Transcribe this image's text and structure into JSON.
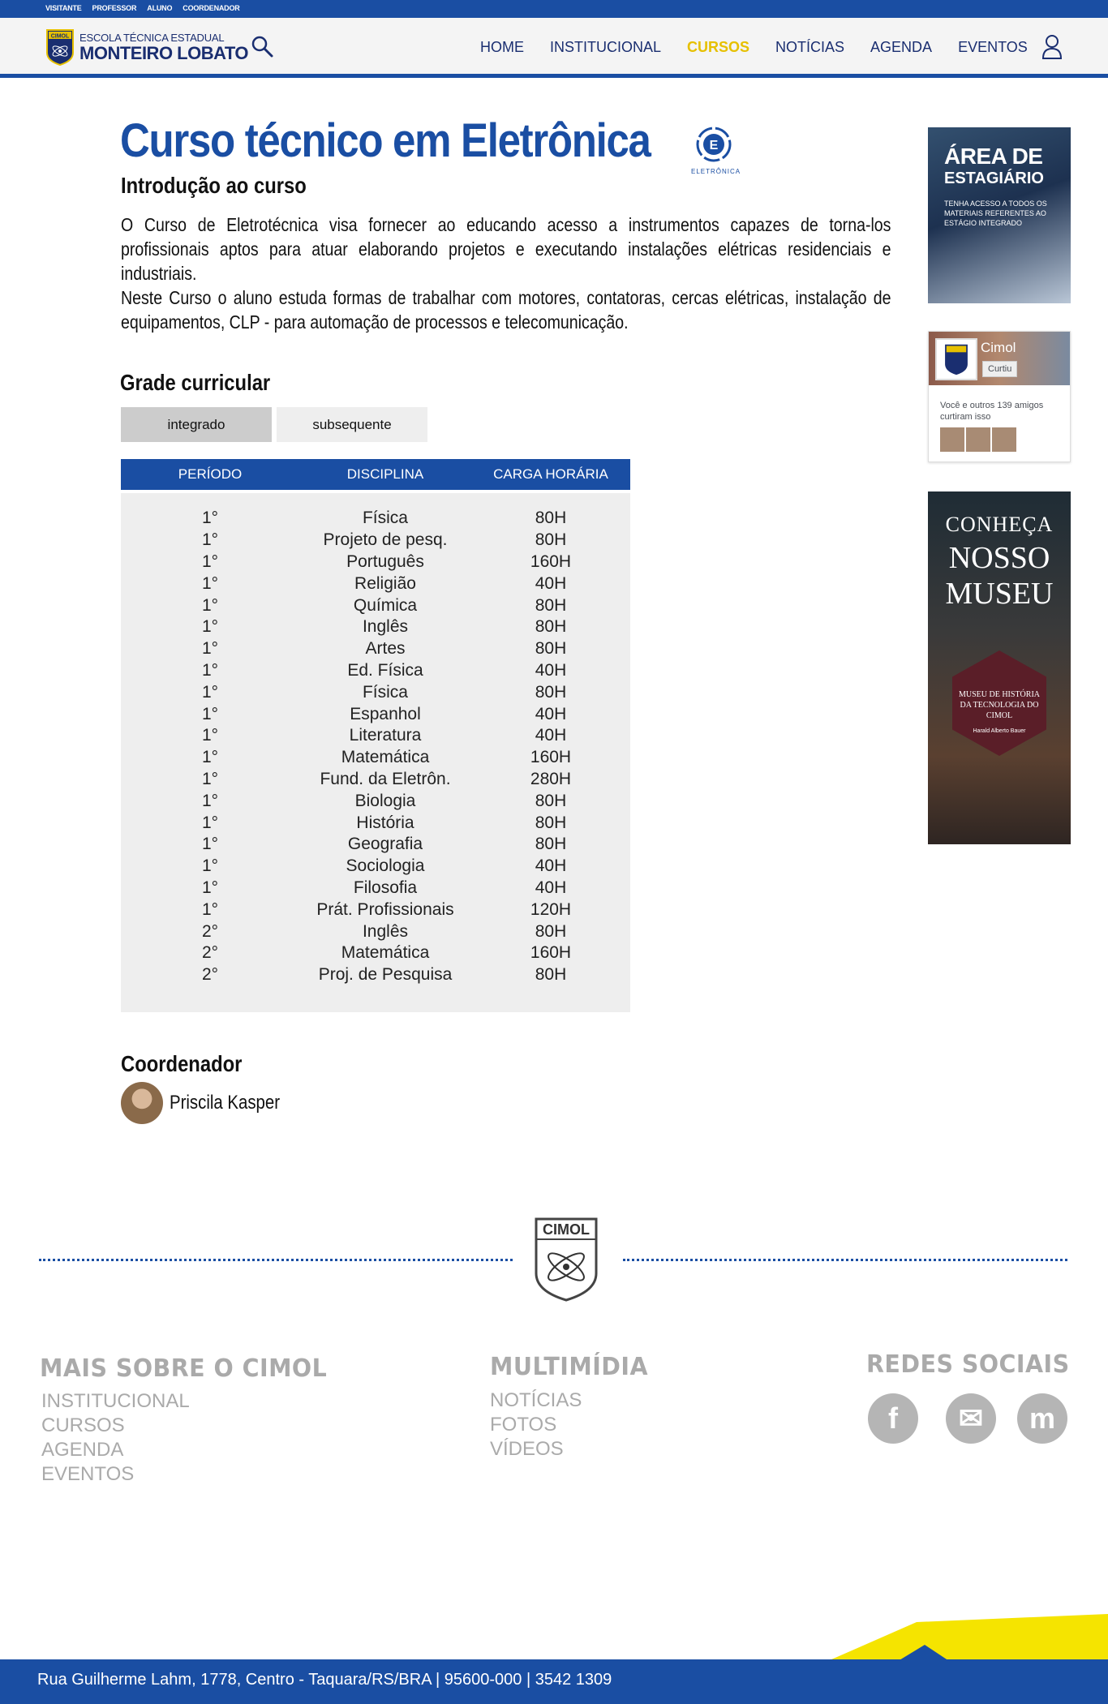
{
  "topbar": {
    "links": [
      "VISITANTE",
      "PROFESSOR",
      "ALUNO",
      "COORDENADOR"
    ]
  },
  "header": {
    "crest_text": "CIMOL",
    "school_sub": "ESCOLA TÉCNICA ESTADUAL",
    "school_main": "MONTEIRO LOBATO",
    "nav": [
      "HOME",
      "INSTITUCIONAL",
      "CURSOS",
      "NOTÍCIAS",
      "AGENDA",
      "EVENTOS"
    ],
    "active_nav": "CURSOS"
  },
  "main": {
    "title": "Curso técnico em Eletrônica",
    "badge_label": "ELETRÔNICA",
    "intro_heading": "Introdução ao curso",
    "intro_p1": "O Curso de Eletrotécnica visa fornecer ao educando acesso a instrumentos capazes de torna-los profissionais aptos para atuar elaborando projetos e executando instalações elétricas residenciais e industriais.",
    "intro_p2": "Neste Curso o aluno estuda formas de trabalhar com motores, contatoras, cercas elétricas, instalação de equipamentos, CLP - para automação de processos e telecomunicação.",
    "grade_heading": "Grade curricular",
    "tabs": [
      "integrado",
      "subsequente"
    ],
    "table": {
      "headers": [
        "PERÍODO",
        "DISCIPLINA",
        "CARGA HORÁRIA"
      ],
      "rows": [
        [
          "1°",
          "Física",
          "80H"
        ],
        [
          "1°",
          "Projeto de pesq.",
          "80H"
        ],
        [
          "1°",
          "Português",
          "160H"
        ],
        [
          "1°",
          "Religião",
          "40H"
        ],
        [
          "1°",
          "Química",
          "80H"
        ],
        [
          "1°",
          "Inglês",
          "80H"
        ],
        [
          "1°",
          "Artes",
          "80H"
        ],
        [
          "1°",
          "Ed. Física",
          "40H"
        ],
        [
          "1°",
          "Física",
          "80H"
        ],
        [
          "1°",
          "Espanhol",
          "40H"
        ],
        [
          "1°",
          "Literatura",
          "40H"
        ],
        [
          "1°",
          "Matemática",
          "160H"
        ],
        [
          "1°",
          "Fund. da Eletrôn.",
          "280H"
        ],
        [
          "1°",
          "Biologia",
          "80H"
        ],
        [
          "1°",
          "História",
          "80H"
        ],
        [
          "1°",
          "Geografia",
          "80H"
        ],
        [
          "1°",
          "Sociologia",
          "40H"
        ],
        [
          "1°",
          "Filosofia",
          "40H"
        ],
        [
          "1°",
          "Prát. Profissionais",
          "120H"
        ],
        [
          "2°",
          "Inglês",
          "80H"
        ],
        [
          "2°",
          "Matemática",
          "160H"
        ],
        [
          "2°",
          "Proj. de Pesquisa",
          "80H"
        ]
      ]
    },
    "coord_heading": "Coordenador",
    "coord_name": "Priscila Kasper"
  },
  "sidebar": {
    "ad1_line1": "ÁREA DE",
    "ad1_line2": "ESTAGIÁRIO",
    "ad1_text": "TENHA ACESSO A TODOS OS MATERIAIS REFERENTES AO ESTÁGIO INTEGRADO",
    "fb_name": "Cimol",
    "fb_like": "Curtiu",
    "fb_friends": "Você e outros 139 amigos curtiram isso",
    "ad2_line1": "CONHEÇA",
    "ad2_line2": "NOSSO",
    "ad2_line3": "MUSEU",
    "ad2_museum": "MUSEU DE HISTÓRIA DA TECNOLOGIA DO CIMOL",
    "ad2_author": "Harald Alberto Bauer"
  },
  "footer": {
    "crest_text": "CIMOL",
    "col1_title": "MAIS SOBRE O CIMOL",
    "col1_links": [
      "INSTITUCIONAL",
      "CURSOS",
      "AGENDA",
      "EVENTOS"
    ],
    "col2_title": "MULTIMÍDIA",
    "col2_links": [
      "NOTÍCIAS",
      "FOTOS",
      "VÍDEOS"
    ],
    "col3_title": "REDES SOCIAIS",
    "social": [
      "facebook-icon",
      "mail-icon",
      "moodle-icon"
    ],
    "social_glyphs": [
      "f",
      "✉",
      "m"
    ],
    "address": "Rua Guilherme Lahm, 1778, Centro - Taquara/RS/BRA | 95600-000 | 3542 1309"
  },
  "colors": {
    "brand_blue": "#1a4ea3",
    "nav_active": "#e6c000",
    "footer_gray": "#aaaaaa",
    "yellow_band": "#f5e400"
  }
}
